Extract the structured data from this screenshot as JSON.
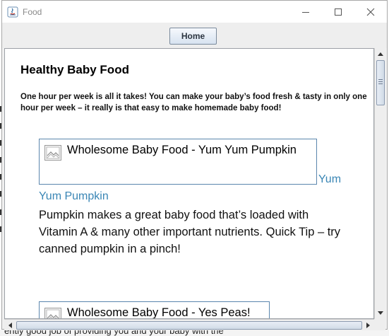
{
  "window": {
    "title": "Food",
    "minimize_icon": "minimize-icon",
    "maximize_icon": "maximize-icon",
    "close_icon": "close-icon"
  },
  "toolbar": {
    "home_label": "Home"
  },
  "page": {
    "title": "Healthy Baby Food",
    "intro_lines": [
      "One hour per week is all it takes! You can make your baby’s food fresh & tasty in only one",
      "hour per week – it really is that easy to make homemade baby food!"
    ],
    "items": [
      {
        "image_alt": "Wholesome Baby Food - Yum Yum Pumpkin",
        "link_part1": "Yum",
        "link_part2": "Yum Pumpkin",
        "description_lines": [
          "Pumpkin makes a great baby food that’s loaded with",
          "Vitamin A & many other important nutrients. Quick Tip – try",
          "canned pumpkin in a pinch!"
        ]
      },
      {
        "image_alt": "Wholesome Baby Food - Yes Peas!"
      }
    ]
  },
  "background_text": "ently good job of providing you and your baby with the",
  "colors": {
    "link": "#3a86b5",
    "image_border": "#5b86ad",
    "button_border": "#7a8a9c"
  }
}
